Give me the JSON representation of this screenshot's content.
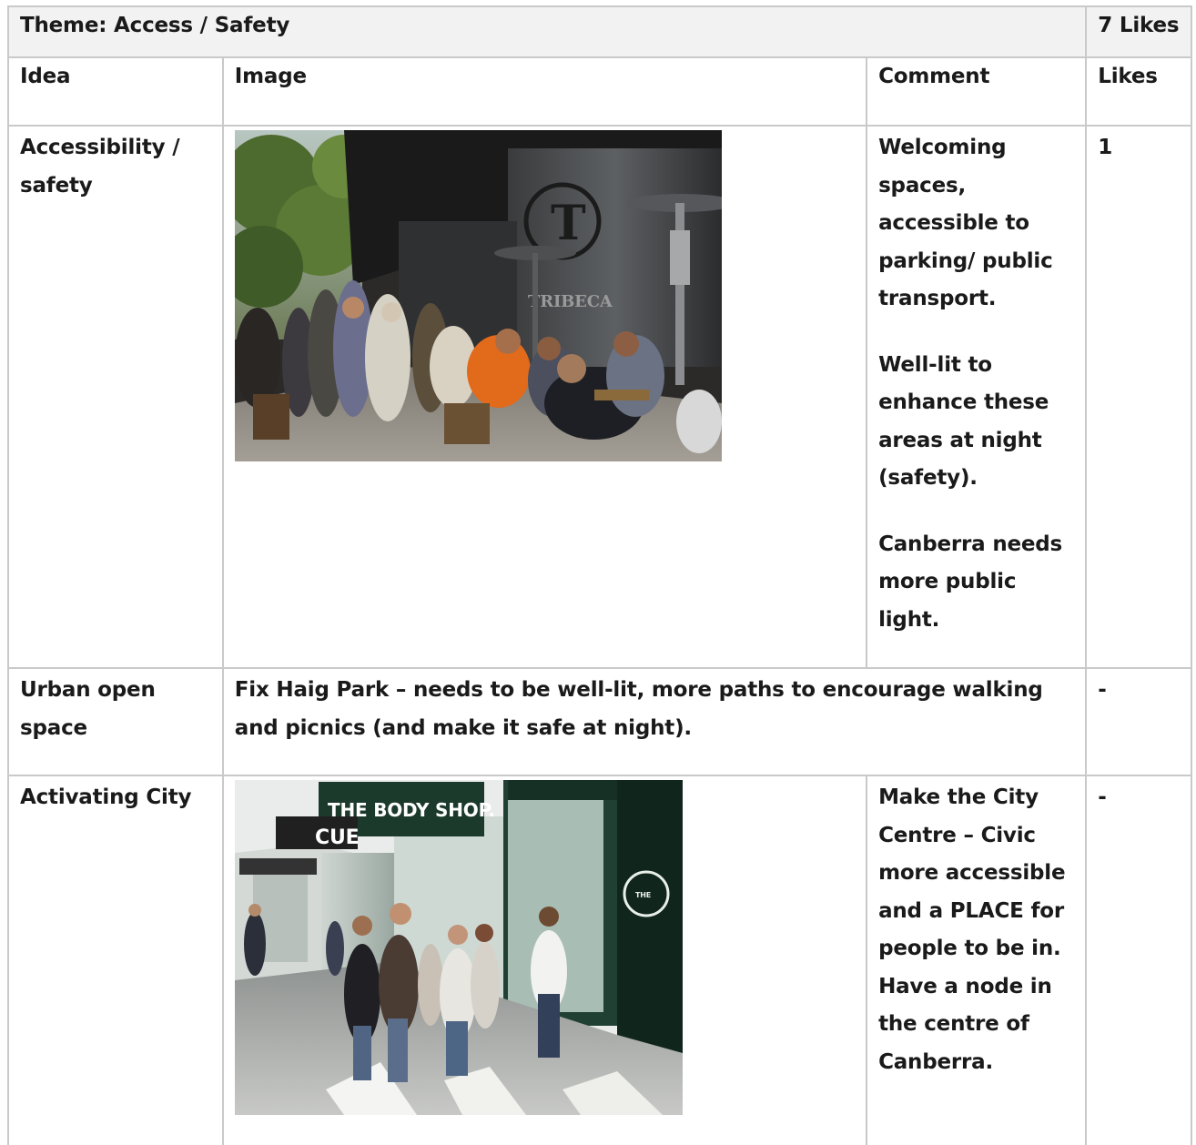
{
  "theme": {
    "title": "Theme: Access / Safety",
    "likes_total": "7 Likes"
  },
  "headers": {
    "idea": "Idea",
    "image": "Image",
    "comment": "Comment",
    "likes": "Likes"
  },
  "rows": [
    {
      "idea_line1": "Accessibility /",
      "idea_line2": "safety",
      "image_signage": "TRIBECA",
      "comment_paragraphs": [
        "Welcoming spaces, accessible to parking/ public transport.",
        "Well-lit to enhance these areas at night (safety).",
        "Canberra needs more public light."
      ],
      "likes": "1"
    },
    {
      "idea_line1": "Urban open",
      "idea_line2": "space",
      "merged_comment": "Fix Haig Park – needs to be well-lit, more paths to encourage walking and picnics (and make it safe at night).",
      "likes": "-"
    },
    {
      "idea": "Activating City",
      "image_signage": [
        "THE BODY SHOP.",
        "CUE"
      ],
      "comment": "Make the City Centre – Civic more accessible and a PLACE for people to be in. Have a node in the centre of Canberra.",
      "likes": "-"
    }
  ]
}
